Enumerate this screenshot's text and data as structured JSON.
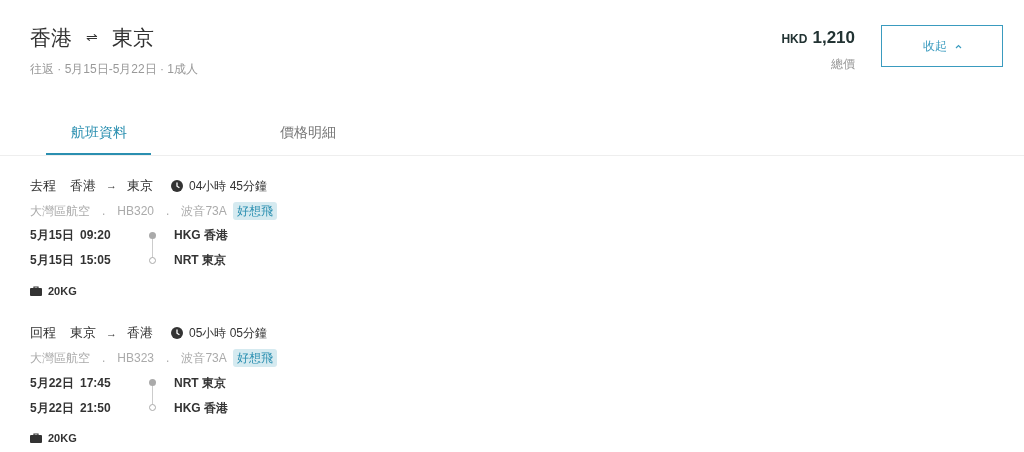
{
  "header": {
    "origin": "香港",
    "swap_symbol": "⇌",
    "destination": "東京",
    "summary": "往返 · 5月15日-5月22日 · 1成人",
    "currency": "HKD",
    "price": "1,210",
    "price_label": "總價",
    "collapse_button": "收起"
  },
  "tabs": [
    {
      "label": "航班資料",
      "selected": true
    },
    {
      "label": "價格明細",
      "selected": false
    }
  ],
  "segments": [
    {
      "direction": "去程",
      "from": "香港",
      "arrow": "→",
      "to": "東京",
      "duration": "04小時 45分鐘",
      "info": [
        "大灣區航空",
        ".",
        "HB320",
        ".",
        "波音73A"
      ],
      "tag": "好想飛",
      "stops": [
        {
          "kind": "departure",
          "date": "5月15日",
          "time": "09:20",
          "airport": "HKG 香港"
        },
        {
          "kind": "arrival",
          "date": "5月15日",
          "time": "15:05",
          "airport": "NRT 東京"
        }
      ],
      "baggage": "20KG"
    },
    {
      "direction": "回程",
      "from": "東京",
      "arrow": "→",
      "to": "香港",
      "duration": "05小時 05分鐘",
      "info": [
        "大灣區航空",
        ".",
        "HB323",
        ".",
        "波音73A"
      ],
      "tag": "好想飛",
      "stops": [
        {
          "kind": "departure",
          "date": "5月22日",
          "time": "17:45",
          "airport": "NRT 東京"
        },
        {
          "kind": "arrival",
          "date": "5月22日",
          "time": "21:50",
          "airport": "HKG 香港"
        }
      ],
      "baggage": "20KG"
    }
  ]
}
